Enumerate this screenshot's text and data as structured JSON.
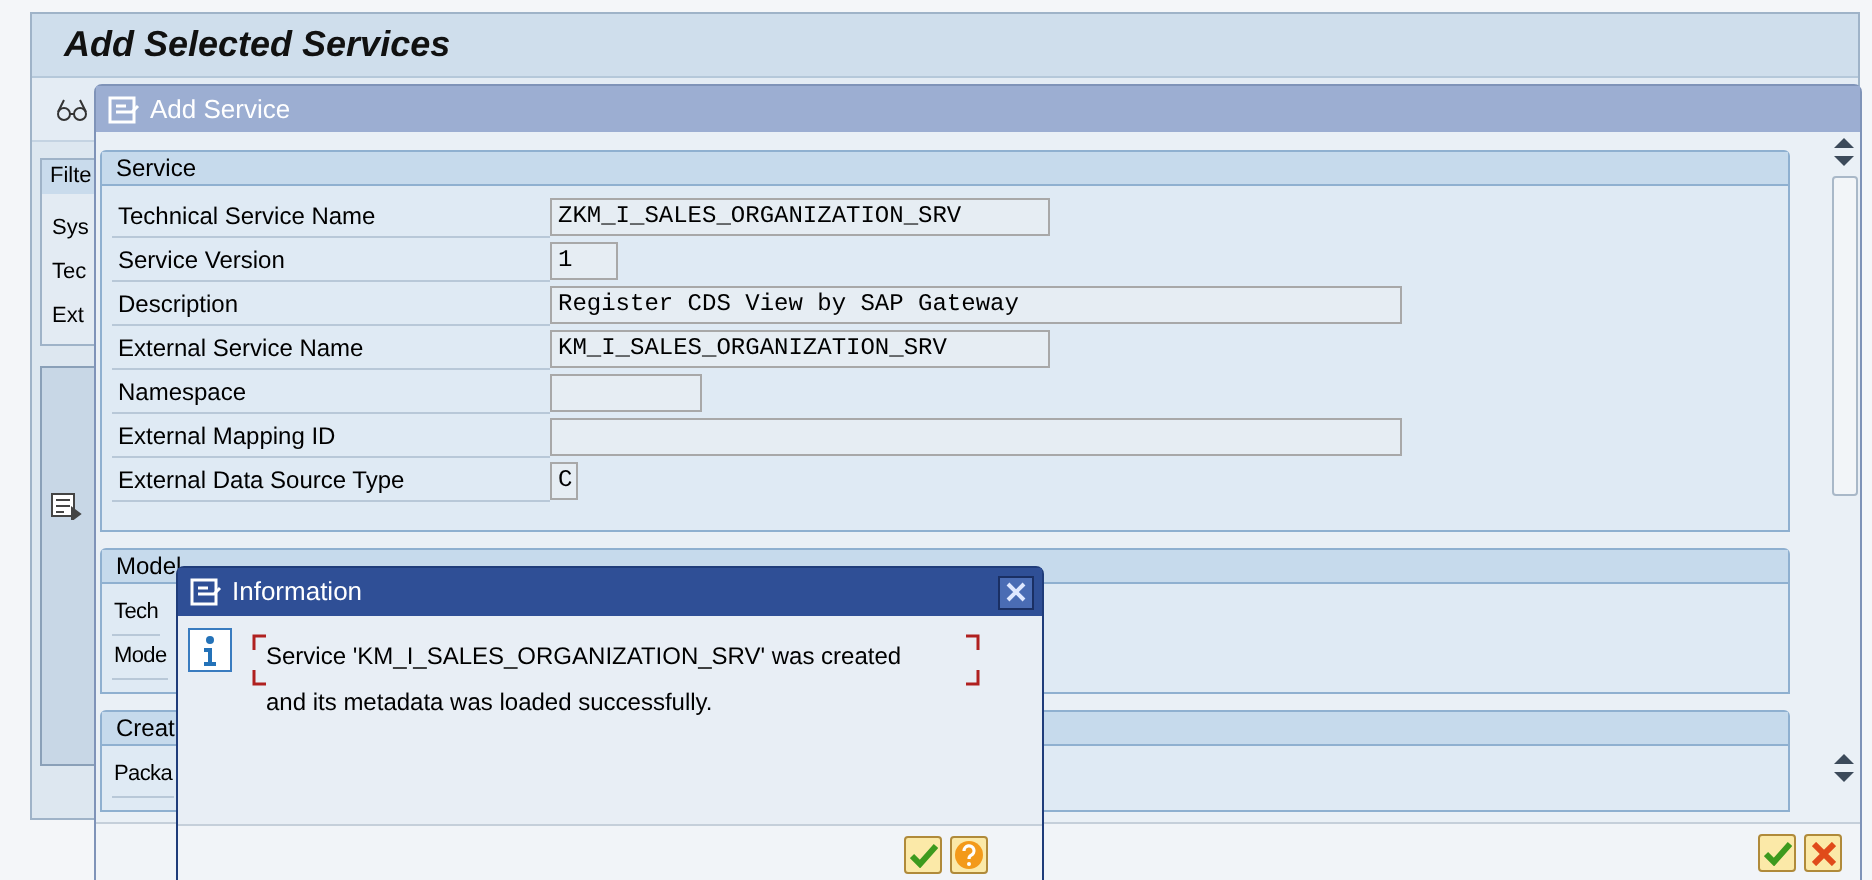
{
  "main_window": {
    "title": "Add Selected Services",
    "filter_tab": "Filte",
    "filter_rows": [
      "Sys",
      "Tec",
      "Ext"
    ]
  },
  "add_service_dialog": {
    "title": "Add Service",
    "groups": [
      {
        "title": "Service",
        "rows": [
          {
            "label": "Technical Service Name",
            "value": "ZKM_I_SALES_ORGANIZATION_SRV"
          },
          {
            "label": "Service Version",
            "value": "1"
          },
          {
            "label": "Description",
            "value": "Register CDS View by SAP Gateway"
          },
          {
            "label": "External Service Name",
            "value": "KM_I_SALES_ORGANIZATION_SRV"
          },
          {
            "label": "Namespace",
            "value": ""
          },
          {
            "label": "External Mapping ID",
            "value": ""
          },
          {
            "label": "External Data Source Type",
            "value": "C"
          }
        ]
      },
      {
        "title": "Model",
        "rows": [
          {
            "label": "Tech"
          },
          {
            "label": "Mode"
          }
        ]
      },
      {
        "title": "Creat",
        "rows": [
          {
            "label": "Packa"
          }
        ]
      }
    ]
  },
  "information_dialog": {
    "title": "Information",
    "message": "Service 'KM_I_SALES_ORGANIZATION_SRV' was created\nand its metadata was loaded successfully."
  }
}
